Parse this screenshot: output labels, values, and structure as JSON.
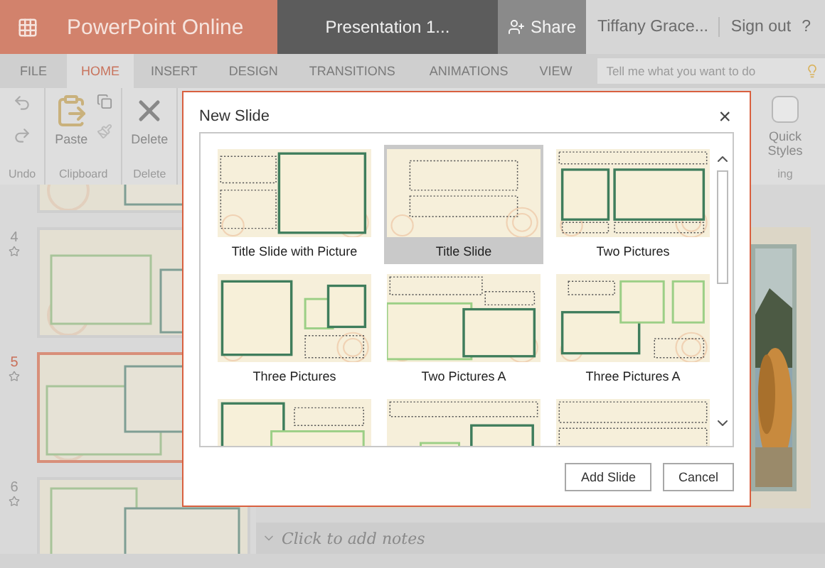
{
  "app": {
    "menu_label": "PowerPoint Online",
    "document": "Presentation 1...",
    "share": "Share",
    "user": "Tiffany Grace...",
    "sign_out": "Sign out",
    "help": "?"
  },
  "tabs": [
    {
      "label": "FILE",
      "selected": false
    },
    {
      "label": "HOME",
      "selected": true
    },
    {
      "label": "INSERT",
      "selected": false
    },
    {
      "label": "DESIGN",
      "selected": false
    },
    {
      "label": "TRANSITIONS",
      "selected": false
    },
    {
      "label": "ANIMATIONS",
      "selected": false
    },
    {
      "label": "VIEW",
      "selected": false
    }
  ],
  "search": {
    "placeholder": "Tell me what you want to do"
  },
  "ribbon": {
    "paste": "Paste",
    "delete": "Delete",
    "quick_styles": "Quick Styles",
    "groups": [
      "Undo",
      "Clipboard",
      "Delete",
      "ing"
    ]
  },
  "slides": [
    {
      "number": "4",
      "selected": false
    },
    {
      "number": "5",
      "selected": true
    },
    {
      "number": "6",
      "selected": false
    }
  ],
  "notes": {
    "placeholder": "Click to add notes"
  },
  "dialog": {
    "title": "New Slide",
    "close": "×",
    "layouts": [
      {
        "label": "Title Slide with Picture",
        "selected": false
      },
      {
        "label": "Title Slide",
        "selected": true
      },
      {
        "label": "Two Pictures",
        "selected": false
      },
      {
        "label": "Three Pictures",
        "selected": false
      },
      {
        "label": "Two Pictures A",
        "selected": false
      },
      {
        "label": "Three Pictures A",
        "selected": false
      },
      {
        "selected": false
      },
      {
        "selected": false
      },
      {
        "selected": false
      }
    ],
    "buttons": [
      "Add Slide",
      "Cancel"
    ]
  }
}
